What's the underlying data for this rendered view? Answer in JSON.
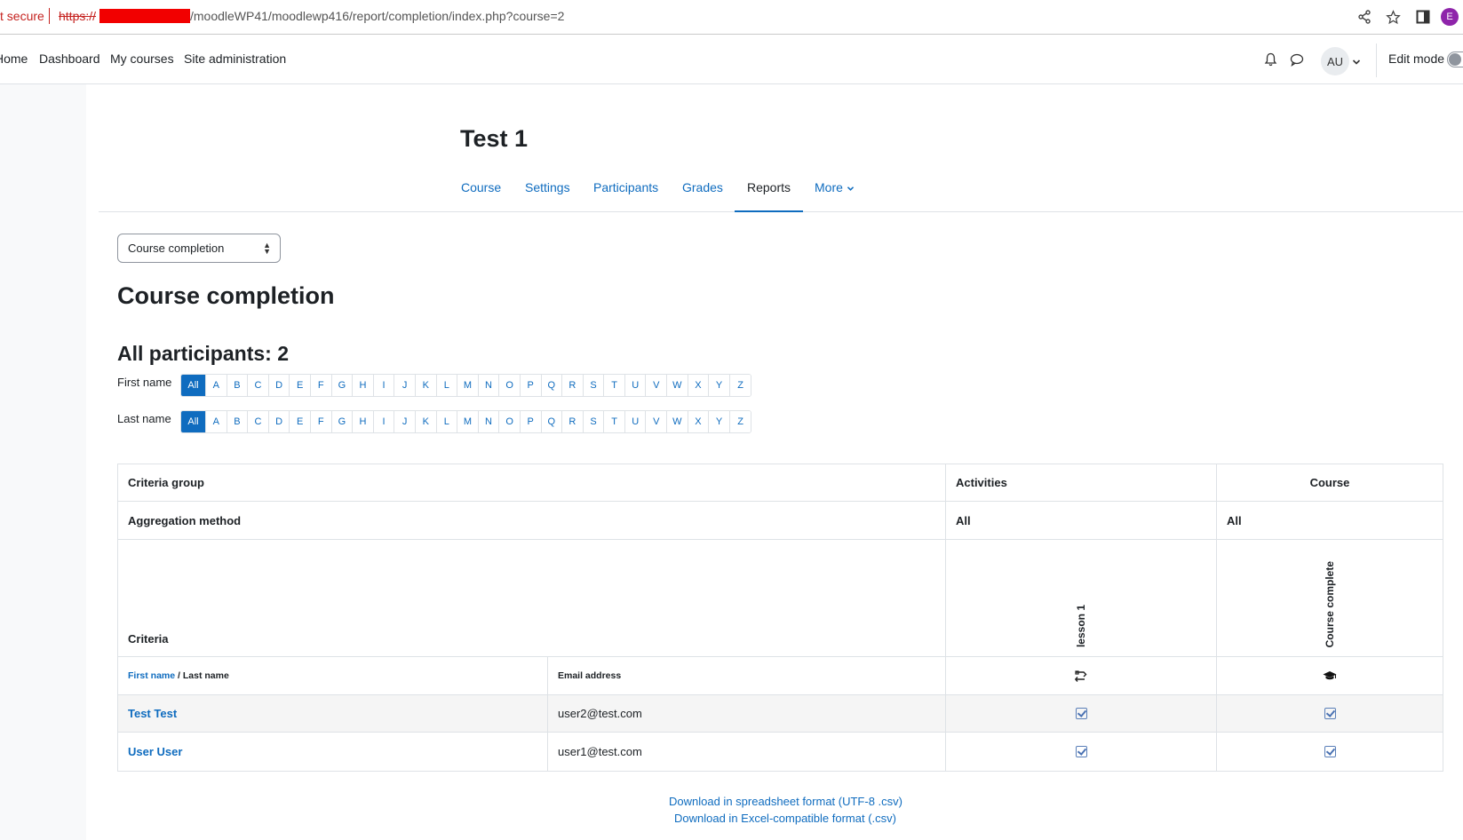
{
  "browser": {
    "security": "t secure",
    "url_scheme": "https://",
    "url_path": "/moodleWP41/moodlewp416/report/completion/index.php?course=2",
    "profile_initial": "E"
  },
  "nav": {
    "items": [
      "Home",
      "Dashboard",
      "My courses",
      "Site administration"
    ],
    "avatar": "AU",
    "edit_mode": "Edit mode"
  },
  "course": {
    "title": "Test 1",
    "tabs": [
      "Course",
      "Settings",
      "Participants",
      "Grades",
      "Reports",
      "More"
    ]
  },
  "report_select": {
    "value": "Course completion"
  },
  "headings": {
    "page": "Course completion",
    "participants": "All participants: 2"
  },
  "initials": {
    "first_label": "First name",
    "last_label": "Last name",
    "all": "All",
    "letters": [
      "A",
      "B",
      "C",
      "D",
      "E",
      "F",
      "G",
      "H",
      "I",
      "J",
      "K",
      "L",
      "M",
      "N",
      "O",
      "P",
      "Q",
      "R",
      "S",
      "T",
      "U",
      "V",
      "W",
      "X",
      "Y",
      "Z"
    ]
  },
  "table": {
    "criteria_group": "Criteria group",
    "activities": "Activities",
    "course": "Course",
    "aggregation_method": "Aggregation method",
    "agg_activities": "All",
    "agg_course": "All",
    "criteria": "Criteria",
    "lesson": "lesson 1",
    "course_complete": "Course complete",
    "first_name": "First name",
    "slash": " / ",
    "last_name": "Last name",
    "email_header": "Email address",
    "rows": [
      {
        "name": "Test Test",
        "email": "user2@test.com"
      },
      {
        "name": "User User",
        "email": "user1@test.com"
      }
    ]
  },
  "downloads": {
    "utf8": "Download in spreadsheet format (UTF-8 .csv)",
    "excel": "Download in Excel-compatible format (.csv)"
  },
  "colors": {
    "brand": "#0f6cbf",
    "text": "#1d2125"
  }
}
